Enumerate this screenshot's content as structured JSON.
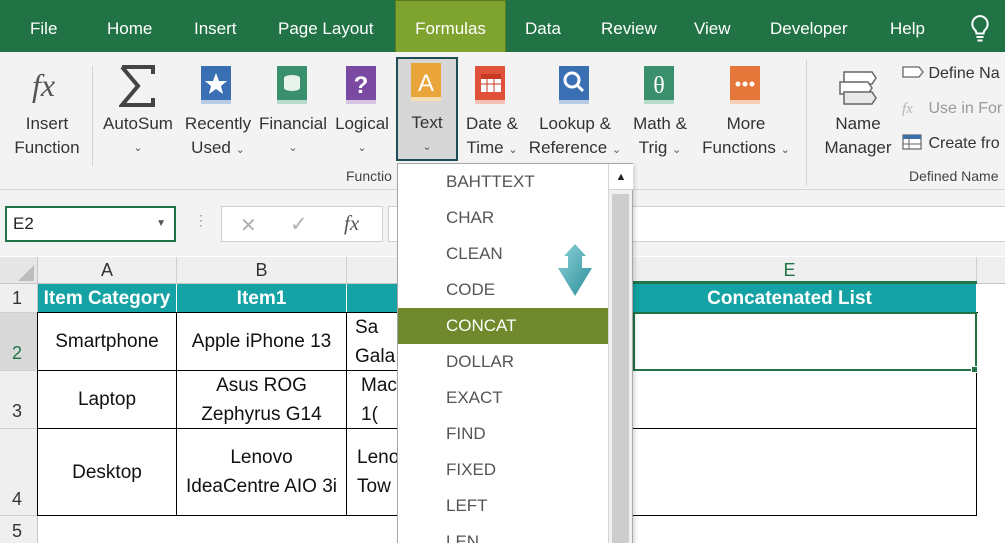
{
  "menu": {
    "tabs": [
      "File",
      "Home",
      "Insert",
      "Page Layout",
      "Formulas",
      "Data",
      "Review",
      "View",
      "Developer",
      "Help"
    ],
    "active": "Formulas"
  },
  "ribbon": {
    "insert_function": [
      "Insert",
      "Function"
    ],
    "autosum": "AutoSum",
    "recently_used": [
      "Recently",
      "Used"
    ],
    "financial": "Financial",
    "logical": "Logical",
    "text": "Text",
    "date_time": [
      "Date &",
      "Time"
    ],
    "lookup": [
      "Lookup &",
      "Reference"
    ],
    "math_trig": [
      "Math &",
      "Trig"
    ],
    "more_functions": [
      "More",
      "Functions"
    ],
    "group_function_library": "Functio",
    "name_manager": [
      "Name",
      "Manager"
    ],
    "define_name": "Define Na",
    "use_in_formula": "Use in For",
    "create_from": "Create fro",
    "group_defined_names": "Defined Name"
  },
  "formula_bar": {
    "name_box": "E2",
    "cancel": "✕",
    "enter": "✓",
    "fx": "fx",
    "value": ""
  },
  "grid": {
    "columns": [
      "A",
      "B",
      "",
      "",
      "E"
    ],
    "rows": [
      "1",
      "2",
      "3",
      "4",
      "5"
    ],
    "headers": [
      "Item Category",
      "Item1",
      "",
      "",
      "Concatenated List"
    ],
    "data": [
      [
        "Smartphone",
        "Apple iPhone 13",
        "Sa\nGala"
      ],
      [
        "Laptop",
        "Asus ROG\nZephyrus G14",
        "Mac\n1("
      ],
      [
        "Desktop",
        "Lenovo\nIdeaCentre AIO 3i",
        "Leno\nTow"
      ]
    ]
  },
  "text_dropdown": {
    "items": [
      "BAHTTEXT",
      "CHAR",
      "CLEAN",
      "CODE",
      "CONCAT",
      "DOLLAR",
      "EXACT",
      "FIND",
      "FIXED",
      "LEFT",
      "LEN"
    ],
    "highlighted": "CONCAT"
  },
  "colors": {
    "ribbon_green": "#217346",
    "active_tab": "#7fa32f",
    "header_fill": "#15a2a4",
    "highlight": "#70892c",
    "arrow_teal": "#3aa7b3"
  }
}
